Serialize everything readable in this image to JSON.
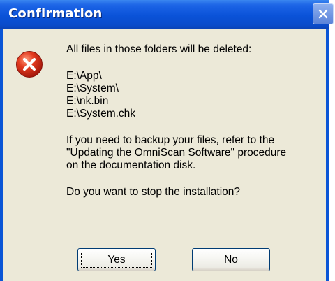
{
  "window": {
    "title": "Confirmation"
  },
  "icons": {
    "error": "error-icon",
    "close": "close-icon"
  },
  "message": {
    "intro": "All files in those folders will be deleted:",
    "paths": [
      "E:\\App\\",
      "E:\\System\\",
      "E:\\nk.bin",
      "E:\\System.chk"
    ],
    "backup_line1": "If you need to backup your files, refer to the",
    "backup_line2": "\"Updating the OmniScan Software\" procedure",
    "backup_line3": "on the documentation disk.",
    "question": "Do you want to stop the installation?"
  },
  "buttons": {
    "yes": "Yes",
    "no": "No"
  },
  "colors": {
    "titlebar": "#0a52d8",
    "client": "#ece9d8",
    "error_red": "#e23a1f"
  }
}
